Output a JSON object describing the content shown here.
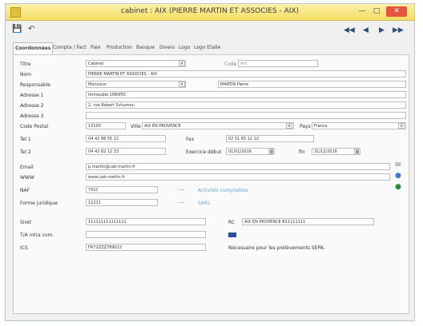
{
  "window": {
    "title": "cabinet : AIX (PIERRE MARTIN ET ASSOCIES - AIX)"
  },
  "titlebar": {
    "minimize": "—",
    "maximize": "□",
    "close": "✕"
  },
  "toolbar": {
    "save_icon": "💾",
    "undo_icon": "↶",
    "first": "◀◀",
    "prev": "◀",
    "next": "▶",
    "last": "▶▶"
  },
  "tabs": [
    "Coordonnées",
    "Compta / Fact",
    "Paie",
    "Production",
    "Banque",
    "Divers",
    "Logo",
    "Logo Etalle"
  ],
  "form": {
    "labels": {
      "titre": "Titre",
      "nom": "Nom",
      "responsable": "Responsable",
      "adresse1": "Adresse 1",
      "adresse2": "Adresse 2",
      "adresse3": "Adresse 3",
      "code_postal": "Code Postal",
      "tel1": "Tel 1",
      "tel2": "Tel 2",
      "email": "Email",
      "www": "WWW",
      "naf": "NAF",
      "forme_juridique": "Forme juridique",
      "siret": "Siret",
      "tva": "T/A intra com.",
      "ics": "ICS",
      "ville": "Ville",
      "pays": "Pays",
      "fax": "Fax",
      "exercice_debut": "Exercice début",
      "fin": "fin",
      "rc": "RC",
      "code": "Code"
    },
    "values": {
      "titre": "Cabinet",
      "code": "AIX",
      "nom": "PIERRE MARTIN ET ASSOCIES - AIX",
      "civilite": "Monsieur",
      "responsable": "MARTIN Pierre",
      "adresse1": "Immeuble CREATIC",
      "adresse2": "2, rue Robert Schuman",
      "adresse3": "",
      "code_postal": "13100",
      "ville": "AIX EN PROVENCE",
      "pays": "France",
      "tel1": "04 42 88 55 22",
      "fax": "02 51 85 12 22",
      "tel2": "04 42 82 12 33",
      "exercice_debut": "01/01/2016",
      "exercice_fin": "31/12/2016",
      "email": "p.martin@cab-martin.fr",
      "www": "www.cab-martin.fr",
      "naf": "741C",
      "naf_desc": "Activités comptables",
      "forme_juridique": "12211",
      "forme_juridique_desc": "SARL",
      "siret": "111111111111111",
      "rc": "AIX EN PROVENCE B11111111",
      "tva": "",
      "ics": "FR72ZZZ789012",
      "ics_note": "Nécessaire pour les prélèvements SEPA."
    }
  },
  "colors": {
    "titlebar": "#f3dd64",
    "accent": "#2d4d77",
    "link": "#6da5d8",
    "close": "#e6533f"
  }
}
